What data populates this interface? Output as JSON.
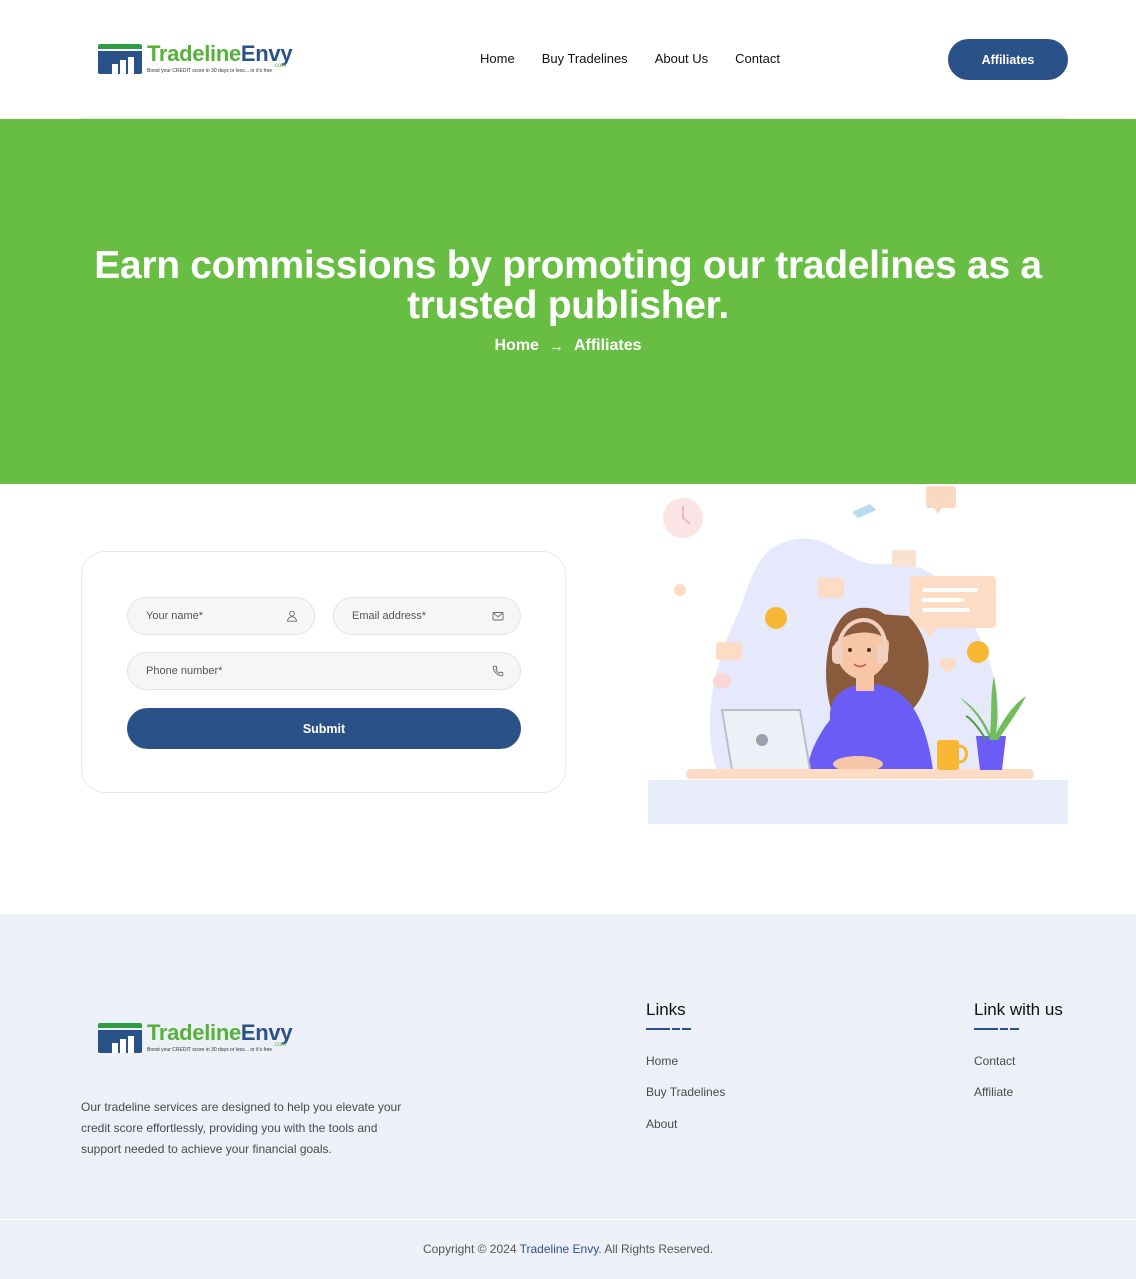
{
  "header": {
    "logo": {
      "word_part1": "Tradeline",
      "word_part2": "Envy",
      "suffix": ".com",
      "tagline": "Boost your CREDIT score in 30 days or less... or it's free"
    },
    "nav": [
      "Home",
      "Buy Tradelines",
      "About Us",
      "Contact"
    ],
    "cta_label": "Affiliates"
  },
  "hero": {
    "title_line1": "Earn commissions by promoting our tradelines as a",
    "title_line2": "trusted publisher.",
    "breadcrumb": {
      "home": "Home",
      "arrow": "→",
      "current": "Affiliates"
    }
  },
  "form": {
    "name_placeholder": "Your name*",
    "email_placeholder": "Email address*",
    "phone_placeholder": "Phone number*",
    "submit_label": "Submit"
  },
  "footer": {
    "logo": {
      "word_part1": "Tradeline",
      "word_part2": "Envy",
      "suffix": ".com",
      "tagline": "Boost your CREDIT score in 30 days or less... or it's free"
    },
    "description": "Our tradeline services are designed to help you elevate your credit score effortlessly, providing you with the tools and support needed to achieve your financial goals.",
    "links_title": "Links",
    "links": [
      "Home",
      "Buy Tradelines",
      "About"
    ],
    "link_with_us_title": "Link with us",
    "link_with_us": [
      "Contact",
      "Affiliate"
    ],
    "copyright_prefix": "Copyright © 2024",
    "copyright_brand": "Tradeline Envy.",
    "copyright_suffix": "All Rights Reserved."
  },
  "colors": {
    "brand_blue": "#2b5189",
    "hero_green": "#68be43",
    "logo_green": "#55b238",
    "footer_bg": "#edf0f8"
  },
  "icons": [
    "user-icon",
    "mail-icon",
    "phone-icon",
    "arrow-right-icon"
  ]
}
